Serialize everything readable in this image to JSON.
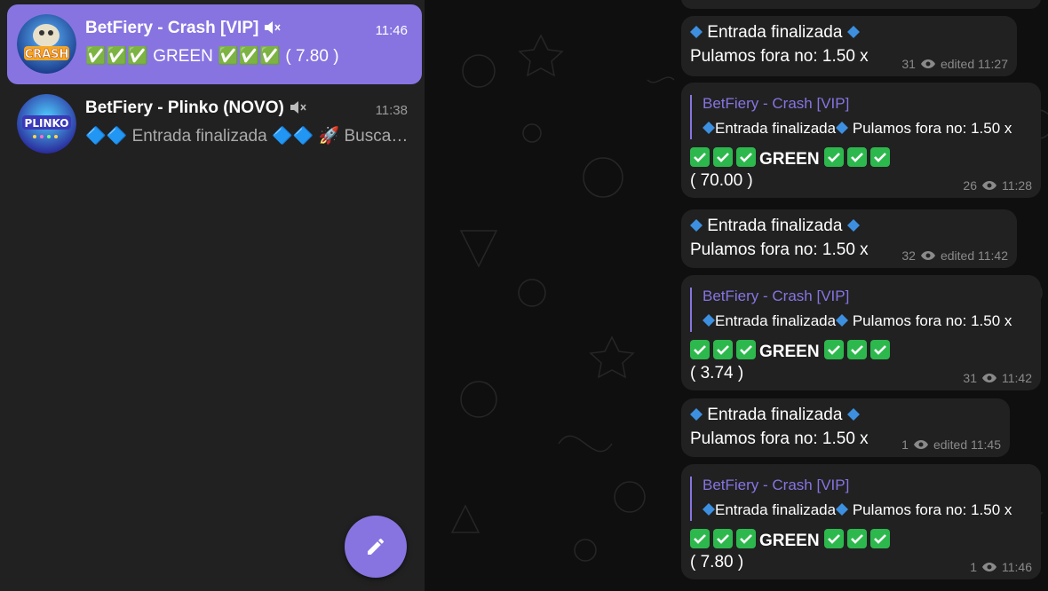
{
  "chats": [
    {
      "title": "BetFiery - Crash [VIP]",
      "time": "11:46",
      "preview": "✅✅✅ GREEN ✅✅✅ ( 7.80 )",
      "avatar_text": "CRASH",
      "active": true
    },
    {
      "title": "BetFiery - Plinko (NOVO)",
      "time": "11:38",
      "preview": "🔷🔷 Entrada finalizada 🔷🔷 🚀 Buscando...",
      "avatar_text": "PLINKO",
      "active": false
    }
  ],
  "messages": [
    {
      "type": "simple",
      "line1": "Entrada finalizada",
      "line2": "Pulamos fora no: 1.50 x",
      "views": "31",
      "edited": "edited 11:27"
    },
    {
      "type": "reply",
      "reply_name": "BetFiery - Crash [VIP]",
      "reply_text1": "Entrada finalizada",
      "reply_text2": "Pulamos fora no: 1.50 x",
      "green": "GREEN",
      "value": "( 70.00 )",
      "views": "26",
      "time": "11:28"
    },
    {
      "type": "simple",
      "line1": "Entrada finalizada",
      "line2": "Pulamos fora no: 1.50 x",
      "views": "32",
      "edited": "edited 11:42"
    },
    {
      "type": "reply",
      "reply_name": "BetFiery - Crash [VIP]",
      "reply_text1": "Entrada finalizada",
      "reply_text2": "Pulamos fora no: 1.50 x",
      "green": "GREEN",
      "value": "( 3.74 )",
      "views": "31",
      "time": "11:42"
    },
    {
      "type": "simple",
      "line1": "Entrada finalizada",
      "line2": "Pulamos fora no: 1.50 x",
      "views": "1",
      "edited": "edited 11:45"
    },
    {
      "type": "reply",
      "reply_name": "BetFiery - Crash [VIP]",
      "reply_text1": "Entrada finalizada",
      "reply_text2": "Pulamos fora no: 1.50 x",
      "green": "GREEN",
      "value": "( 7.80 )",
      "views": "1",
      "time": "11:46"
    }
  ],
  "colors": {
    "accent": "#8774e1",
    "bubble": "#212121",
    "sidebar": "#212121",
    "check": "#2db84d",
    "diamond": "#3d8fe0"
  },
  "icons": {
    "mute": "muted-speaker-icon",
    "compose": "pencil-icon",
    "views": "eye-icon",
    "diamond": "blue-diamond-icon",
    "check": "green-check-icon"
  }
}
